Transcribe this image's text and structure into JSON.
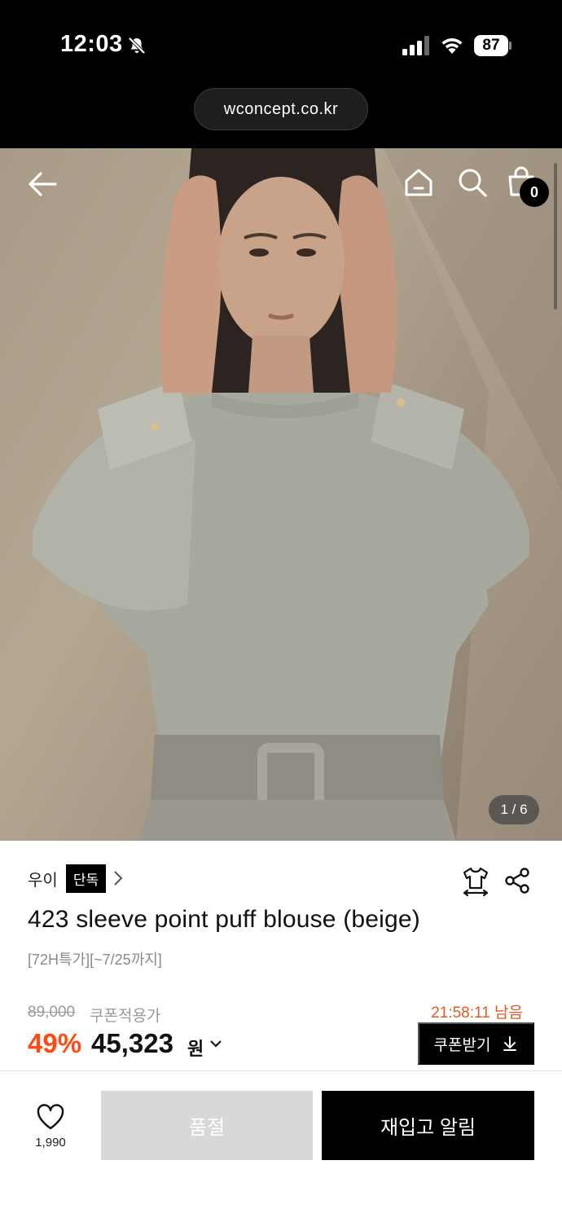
{
  "status_bar": {
    "time": "12:03",
    "battery": "87",
    "icons": [
      "bell-muted-icon",
      "signal-icon",
      "wifi-icon",
      "battery-icon"
    ]
  },
  "browser": {
    "url": "wconcept.co.kr"
  },
  "hero": {
    "cart_count": "0",
    "image_counter": "1 / 6",
    "icons": [
      "back-arrow-icon",
      "home-icon",
      "search-icon",
      "shopping-bag-icon"
    ]
  },
  "product": {
    "brand": "우이",
    "exclusive_badge": "단독",
    "title": "423 sleeve point puff blouse (beige)",
    "promo": "[72H특가][~7/25까지]",
    "original_price": "89,000",
    "coupon_price_label": "쿠폰적용가",
    "discount": "49%",
    "price": "45,323",
    "currency": "원",
    "timer": "21:58:11 남음",
    "coupon_button": "쿠폰받기",
    "discount_color": "#ff4b12",
    "timer_color": "#e05a23"
  },
  "bottom_bar": {
    "like_count": "1,990",
    "soldout_label": "품절",
    "restock_label": "재입고 알림"
  }
}
